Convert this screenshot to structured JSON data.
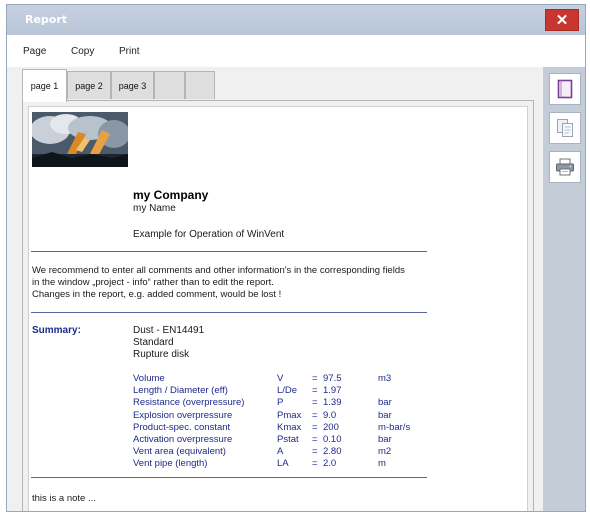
{
  "window": {
    "title": "Report"
  },
  "menu": {
    "page": "Page",
    "copy": "Copy",
    "print": "Print"
  },
  "tabs": [
    {
      "label": "page 1"
    },
    {
      "label": "page 2"
    },
    {
      "label": "page 3"
    },
    {
      "label": ""
    },
    {
      "label": ""
    }
  ],
  "report": {
    "company": "my Company",
    "name": "my Name",
    "example": "Example for Operation of WinVent",
    "notice_lines": [
      "We recommend to enter all comments and other information's in the corresponding fields",
      "in the window „project - info“ rather than to edit the report.",
      "Changes in the report, e.g. added comment, would be lost !"
    ],
    "summary_label": "Summary:",
    "summary_lines": [
      "Dust - EN14491",
      "Standard",
      "Rupture disk"
    ],
    "parameters": [
      {
        "label": "Volume",
        "symbol": "V",
        "eq": "=",
        "value": "97.5",
        "unit": "m3"
      },
      {
        "label": "Length / Diameter (eff)",
        "symbol": "L/De",
        "eq": "=",
        "value": "1.97",
        "unit": ""
      },
      {
        "label": "Resistance (overpressure)",
        "symbol": "P",
        "eq": "=",
        "value": "1.39",
        "unit": "bar"
      },
      {
        "label": "Explosion overpressure",
        "symbol": "Pmax",
        "eq": "=",
        "value": "9.0",
        "unit": "bar"
      },
      {
        "label": "Product-spec. constant",
        "symbol": "Kmax",
        "eq": "=",
        "value": "200",
        "unit": "m-bar/s"
      },
      {
        "label": "Activation overpressure",
        "symbol": "Pstat",
        "eq": "=",
        "value": "0.10",
        "unit": "bar"
      },
      {
        "label": "Vent area  (equivalent)",
        "symbol": "A",
        "eq": "=",
        "value": "2.80",
        "unit": "m2"
      },
      {
        "label": "Vent pipe  (length)",
        "symbol": "LA",
        "eq": "=",
        "value": "2.0",
        "unit": "m"
      }
    ],
    "note": "this is a note ..."
  },
  "side_buttons": {
    "page": "page-icon",
    "copy": "copy-icon",
    "print": "printer-icon"
  },
  "colors": {
    "accent": "#1c2a8c",
    "close": "#c7372f",
    "titlebar": "#bdc9da",
    "divider": "#5f67a3"
  }
}
